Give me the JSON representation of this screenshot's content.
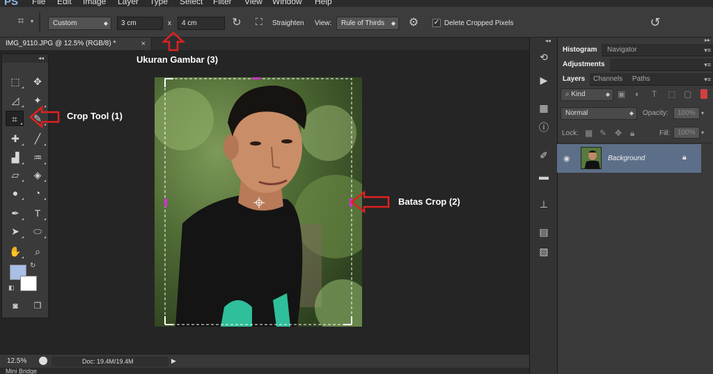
{
  "app": {
    "logo": "PS"
  },
  "menu": [
    "File",
    "Edit",
    "Image",
    "Layer",
    "Type",
    "Select",
    "Filter",
    "View",
    "Window",
    "Help"
  ],
  "options": {
    "ratio_preset": "Custom",
    "width_value": "3 cm",
    "times_symbol": "x",
    "height_value": "4 cm",
    "straighten_label": "Straighten",
    "view_label": "View:",
    "view_value": "Rule of Thirds",
    "delete_cropped_label": "Delete Cropped Pixels",
    "delete_cropped_checked": true
  },
  "document": {
    "tab_title": "IMG_9110.JPG @ 12.5% (RGB/8) *",
    "close_symbol": "×",
    "zoom": "12.5%",
    "doc_size": "Doc: 19.4M/19.4M"
  },
  "annotations": {
    "size_label": "Ukuran Gambar",
    "size_num": "(3)",
    "crop_tool_label": "Crop Tool",
    "crop_tool_num": "(1)",
    "crop_bounds_label": "Batas Crop",
    "crop_bounds_num": "(2)"
  },
  "panels": {
    "top_tabs": [
      "Histogram",
      "Navigator"
    ],
    "adjustments": "Adjustments",
    "layer_tabs": [
      "Layers",
      "Channels",
      "Paths"
    ],
    "kind_filter": "Kind",
    "blend_mode": "Normal",
    "opacity_label": "Opacity:",
    "opacity_value": "100%",
    "lock_label": "Lock:",
    "fill_label": "Fill:",
    "fill_value": "100%",
    "layer_name": "Background"
  },
  "bottom": {
    "mini_bridge": "Mini Bridge"
  },
  "colors": {
    "accent": "#e02020",
    "foreground_swatch": "#a8bfe6",
    "background_swatch": "#ffffff",
    "selected_layer": "#5d6f88"
  }
}
